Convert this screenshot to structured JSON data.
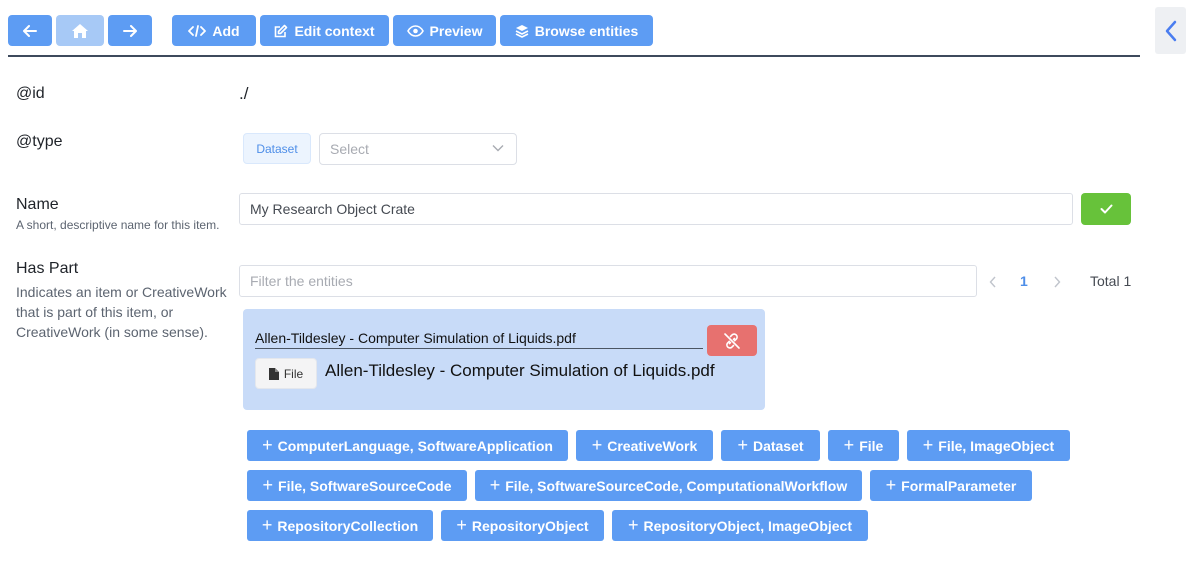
{
  "toolbar": {
    "add_label": "Add",
    "edit_context_label": "Edit context",
    "preview_label": "Preview",
    "browse_entities_label": "Browse entities"
  },
  "colors": {
    "primary": "#5d9cf3",
    "success": "#67c23a",
    "danger": "#e7716f",
    "card": "#c8dbf8"
  },
  "id_field": {
    "label": "@id",
    "value": "./"
  },
  "type_field": {
    "label": "@type",
    "tag": "Dataset",
    "select_placeholder": "Select"
  },
  "name_field": {
    "label": "Name",
    "help": "A short, descriptive name for this item.",
    "value": "My Research Object Crate"
  },
  "has_part": {
    "label": "Has Part",
    "help_lines": [
      "Indicates an item or CreativeWork",
      "that is part of this item, or",
      "CreativeWork (in some sense)."
    ],
    "filter_placeholder": "Filter the entities",
    "pagination": {
      "current_page": "1",
      "total": "Total 1"
    },
    "entity": {
      "name_value": "Allen-Tildesley - Computer Simulation of Liquids.pdf",
      "type_label": "File",
      "title": "Allen-Tildesley - Computer Simulation of Liquids.pdf"
    },
    "add_buttons": [
      "ComputerLanguage, SoftwareApplication",
      "CreativeWork",
      "Dataset",
      "File",
      "File, ImageObject",
      "File, SoftwareSourceCode",
      "File, SoftwareSourceCode, ComputationalWorkflow",
      "FormalParameter",
      "RepositoryCollection",
      "RepositoryObject",
      "RepositoryObject, ImageObject"
    ]
  }
}
